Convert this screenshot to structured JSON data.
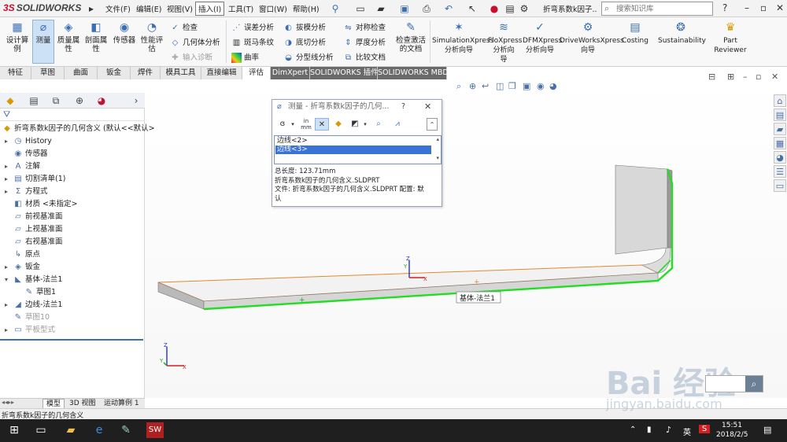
{
  "app": {
    "logo_ds": "3S",
    "logo_name": "SOLIDWORKS",
    "doc_title": "折弯系数k因子...",
    "search_placeholder": "搜索知识库"
  },
  "menus": [
    "文件(F)",
    "编辑(E)",
    "视图(V)",
    "插入(I)",
    "工具(T)",
    "窗口(W)",
    "帮助(H)"
  ],
  "active_menu": "插入(I)",
  "ribbon": {
    "big_buttons": [
      {
        "label": "设计算\n例",
        "icon": "design-study-icon"
      },
      {
        "label": "测量",
        "icon": "measure-icon",
        "selected": true
      },
      {
        "label": "质量属\n性",
        "icon": "mass-properties-icon"
      },
      {
        "label": "剖面属\n性",
        "icon": "section-properties-icon"
      },
      {
        "label": "传感器",
        "icon": "sensor-icon"
      },
      {
        "label": "性能评\n估",
        "icon": "performance-icon"
      }
    ],
    "col1": [
      {
        "label": "检查",
        "icon": "check-icon"
      },
      {
        "label": "几何体分析",
        "icon": "geometry-analysis-icon"
      },
      {
        "label": "输入诊断",
        "icon": "import-diagnostics-icon",
        "disabled": true
      }
    ],
    "col2": [
      {
        "label": "误差分析",
        "icon": "deviation-analysis-icon"
      },
      {
        "label": "斑马条纹",
        "icon": "zebra-stripes-icon"
      },
      {
        "label": "曲率",
        "icon": "curvature-icon"
      }
    ],
    "col3": [
      {
        "label": "拔模分析",
        "icon": "draft-analysis-icon"
      },
      {
        "label": "底切分析",
        "icon": "undercut-analysis-icon"
      },
      {
        "label": "分型线分析",
        "icon": "parting-line-icon"
      }
    ],
    "col4": [
      {
        "label": "对称检查",
        "icon": "symmetry-check-icon"
      },
      {
        "label": "厚度分析",
        "icon": "thickness-analysis-icon"
      },
      {
        "label": "比较文档",
        "icon": "compare-documents-icon"
      }
    ],
    "activate_doc": "检查激活\n的文档",
    "addins": [
      {
        "label": "SimulationXpress\n分析向导",
        "icon": "simulation-icon"
      },
      {
        "label": "FloXpress\n分析向\n导",
        "icon": "floxpress-icon"
      },
      {
        "label": "DFMXpress\n分析向导",
        "icon": "dfmxpress-icon"
      },
      {
        "label": "DriveWorksXpress\n向导",
        "icon": "driveworks-icon"
      },
      {
        "label": "Costing",
        "icon": "costing-icon"
      },
      {
        "label": "Sustainability",
        "icon": "sustainability-icon"
      },
      {
        "label": "Part\nReviewer",
        "icon": "part-reviewer-icon"
      }
    ]
  },
  "tabs": [
    "特征",
    "草图",
    "曲面",
    "钣金",
    "焊件",
    "模具工具",
    "直接编辑",
    "评估",
    "DimXpert",
    "SOLIDWORKS 插件",
    "SOLIDWORKS MBD"
  ],
  "active_tab": "评估",
  "tree": {
    "root": "折弯系数k因子的几何含义 (默认<<默认>",
    "items": [
      {
        "label": "History",
        "icon": "history-icon",
        "arrow": "▸"
      },
      {
        "label": "传感器",
        "icon": "sensor-folder-icon",
        "arrow": ""
      },
      {
        "label": "注解",
        "icon": "annotations-icon",
        "arrow": "▸"
      },
      {
        "label": "切割清单(1)",
        "icon": "cut-list-icon",
        "arrow": "▸"
      },
      {
        "label": "方程式",
        "icon": "equations-icon",
        "arrow": "▸"
      },
      {
        "label": "材质 <未指定>",
        "icon": "material-icon",
        "arrow": ""
      },
      {
        "label": "前视基准面",
        "icon": "plane-icon",
        "arrow": ""
      },
      {
        "label": "上视基准面",
        "icon": "plane-icon",
        "arrow": ""
      },
      {
        "label": "右视基准面",
        "icon": "plane-icon",
        "arrow": ""
      },
      {
        "label": "原点",
        "icon": "origin-icon",
        "arrow": ""
      },
      {
        "label": "钣金",
        "icon": "sheet-metal-icon",
        "arrow": "▸"
      },
      {
        "label": "基体-法兰1",
        "icon": "base-flange-icon",
        "arrow": "▾"
      },
      {
        "label": "草图1",
        "icon": "sketch-icon",
        "arrow": "",
        "indent": true
      },
      {
        "label": "边线-法兰1",
        "icon": "edge-flange-icon",
        "arrow": "▸"
      },
      {
        "label": "草图10",
        "icon": "sketch-icon",
        "arrow": "",
        "gray": true
      },
      {
        "label": "平板型式",
        "icon": "flat-pattern-icon",
        "arrow": "▸",
        "gray": true
      }
    ]
  },
  "model_tabs": [
    "模型",
    "3D 视图",
    "运动算例 1"
  ],
  "status_text": "折弯系数k因子的几何含义",
  "dialog": {
    "title": "测量 - 折弯系数k因子的几何...",
    "help": "?",
    "close": "✕",
    "list": [
      "边线<2>",
      "边线<3>"
    ],
    "selected_index": 1,
    "results": [
      "总长度: 123.71mm",
      "折弯系数k因子的几何含义.SLDPRT",
      "文件:  折弯系数k因子的几何含义.SLDPRT 配置: 默",
      "认"
    ]
  },
  "viewport": {
    "callout": "基体-法兰1",
    "axis_x": "X",
    "axis_y": "Y",
    "axis_z": "Z"
  },
  "watermark": {
    "brand": "Bai 经验",
    "url": "jingyan.baidu.com"
  },
  "clock": {
    "time": "15:51",
    "date": "2018/2/5"
  },
  "ime": "英"
}
